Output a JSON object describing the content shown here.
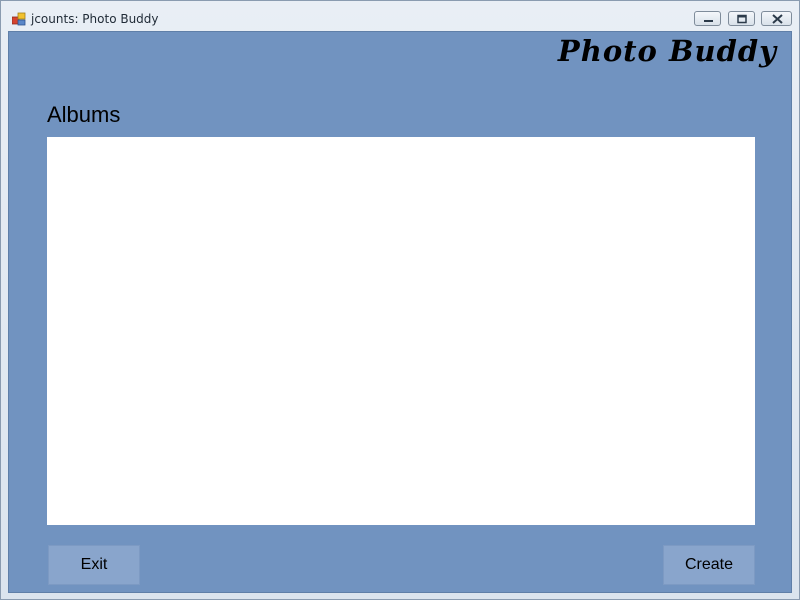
{
  "window": {
    "title": "jcounts: Photo Buddy",
    "app_icon": "app-icon",
    "controls": {
      "minimize_icon": "minimize-icon",
      "maximize_icon": "restore-icon",
      "close_icon": "close-icon"
    }
  },
  "header": {
    "brand": "Photo Buddy"
  },
  "albums": {
    "label": "Albums",
    "items": []
  },
  "buttons": {
    "exit_label": "Exit",
    "create_label": "Create"
  },
  "colors": {
    "client_background": "#7193c0",
    "button_background": "#89a5cc",
    "list_background": "#ffffff"
  }
}
